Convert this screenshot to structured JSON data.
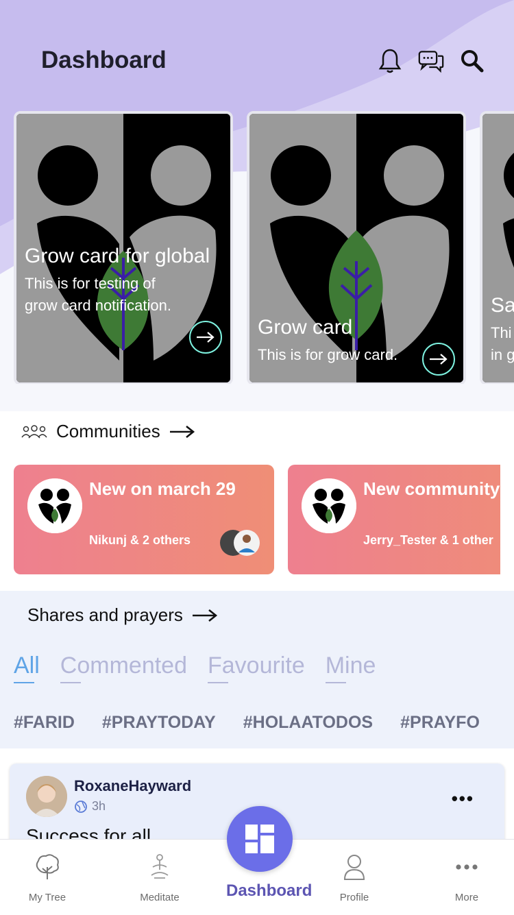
{
  "header": {
    "title": "Dashboard"
  },
  "colors": {
    "accent": "#6b6ee8",
    "hero": "#c7bfef",
    "card_arrow": "#7ef2e0",
    "community_from": "#ee808f",
    "community_to": "#ef8e76"
  },
  "grow_cards": [
    {
      "title": "Grow card for global",
      "subtitle": "This is for testing of grow card notification."
    },
    {
      "title": "Grow card",
      "subtitle": "This is for grow card."
    },
    {
      "title": "Sa",
      "subtitle": "Thi in g"
    }
  ],
  "communities": {
    "label": "Communities",
    "items": [
      {
        "name": "New on march 29",
        "members": "Nikunj & 2 others"
      },
      {
        "name": "New community",
        "members": "Jerry_Tester & 1 other"
      }
    ]
  },
  "shares": {
    "label": "Shares and prayers",
    "filters": [
      "All",
      "Commented",
      "Favourite",
      "Mine"
    ],
    "active_filter": "All",
    "tags": [
      "#FARID",
      "#PRAYTODAY",
      "#HOLAATODOS",
      "#PRAYFO"
    ]
  },
  "post": {
    "user": "RoxaneHayward",
    "time": "3h",
    "text": "Success for all"
  },
  "tabbar": {
    "my_tree": "My Tree",
    "meditate": "Meditate",
    "dashboard": "Dashboard",
    "profile": "Profile",
    "more": "More"
  }
}
